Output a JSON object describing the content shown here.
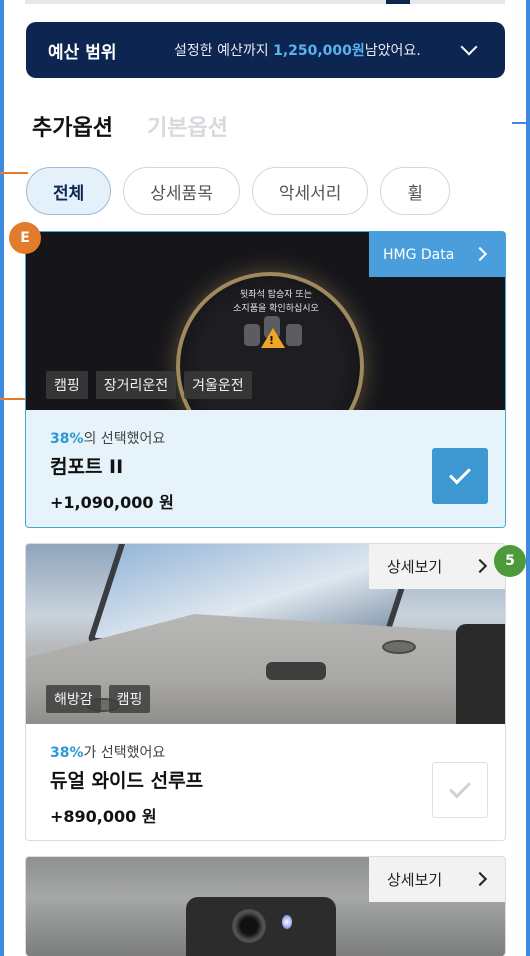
{
  "budget": {
    "label": "예산 범위",
    "text_before": "설정한 예산까지",
    "amount": "1,250,000원",
    "text_after": "남았어요."
  },
  "tabs": [
    {
      "label": "추가옵션",
      "active": true
    },
    {
      "label": "기본옵션",
      "active": false
    }
  ],
  "filters": [
    {
      "label": "전체",
      "active": true
    },
    {
      "label": "상세품목",
      "active": false
    },
    {
      "label": "악세서리",
      "active": false
    },
    {
      "label": "휠",
      "active": false
    }
  ],
  "badges": {
    "e": "E",
    "five": "5"
  },
  "options": [
    {
      "image_text": "뒷좌석 탑승자 또는\n소지품을 확인하십시오",
      "top_button": "HMG Data",
      "tags": [
        "캠핑",
        "장거리운전",
        "겨울운전"
      ],
      "pct": "38%",
      "pct_suffix": "의 선택했어요",
      "name": "컴포트 II",
      "price": "+1,090,000 원",
      "selected": true
    },
    {
      "top_button": "상세보기",
      "tags": [
        "해방감",
        "캠핑"
      ],
      "pct": "38%",
      "pct_suffix": "가 선택했어요",
      "name": "듀얼 와이드 선루프",
      "price": "+890,000 원",
      "selected": false
    },
    {
      "top_button": "상세보기"
    }
  ],
  "colors": {
    "navy": "#0c2551",
    "accent_blue": "#3d97d0",
    "highlight": "#5ab2f0",
    "badge_orange": "#e27b2c",
    "badge_green": "#4d9a3b"
  }
}
